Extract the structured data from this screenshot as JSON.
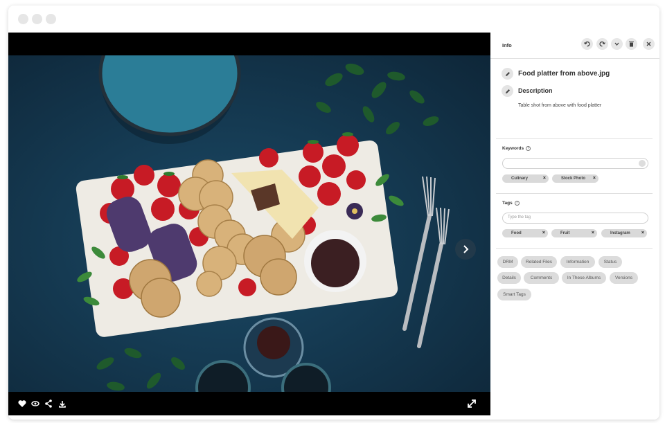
{
  "panel": {
    "title": "Info",
    "header_buttons": [
      "undo-icon",
      "redo-icon",
      "chevron-down-icon",
      "trash-icon",
      "close-icon"
    ],
    "file_name": "Food platter from above.jpg",
    "description_label": "Description",
    "description_text": "Table shot from above with food platter",
    "keywords_label": "Keywords",
    "keywords": [
      "Culinary",
      "Stock Photo"
    ],
    "tags_label": "Tags",
    "tags_placeholder": "Type the tag",
    "tags": [
      "Food",
      "Fruit",
      "Instagram"
    ],
    "sections": [
      "DRM",
      "Related Files",
      "Information",
      "Status",
      "Details",
      "Comments",
      "In These Albums",
      "Versions",
      "Smart Tags"
    ]
  },
  "viewer": {
    "footer_icons": [
      "heart-icon",
      "eye-icon",
      "share-icon",
      "download-icon"
    ],
    "fullscreen_icon": "expand-icon",
    "next_icon": "chevron-right-icon"
  }
}
